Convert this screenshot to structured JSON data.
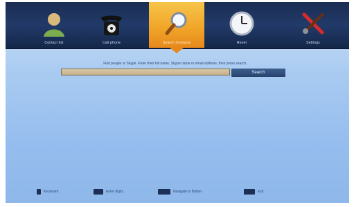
{
  "tabs": [
    {
      "label": "Contact list",
      "icon": "contact-icon"
    },
    {
      "label": "Call phone",
      "icon": "phone-icon"
    },
    {
      "label": "Search Contacts",
      "icon": "search-icon",
      "active": true
    },
    {
      "label": "Reset",
      "icon": "clock-icon"
    },
    {
      "label": "Settings",
      "icon": "tools-icon"
    }
  ],
  "search": {
    "prompt": "Find people or Skype. Enter their full name, Skype name or email address, then press search.",
    "value": "",
    "button_label": "Search"
  },
  "footer": {
    "hints": [
      {
        "key": "",
        "label": "Keyboard"
      },
      {
        "key": "",
        "label": "Enter digits"
      },
      {
        "key": "",
        "label": "Navigate to Button"
      },
      {
        "key": "",
        "label": "Exit"
      }
    ],
    "note": ""
  },
  "colors": {
    "accent": "#f1a629",
    "topbar": "#1a2d52",
    "background": "#a9cbf1"
  }
}
